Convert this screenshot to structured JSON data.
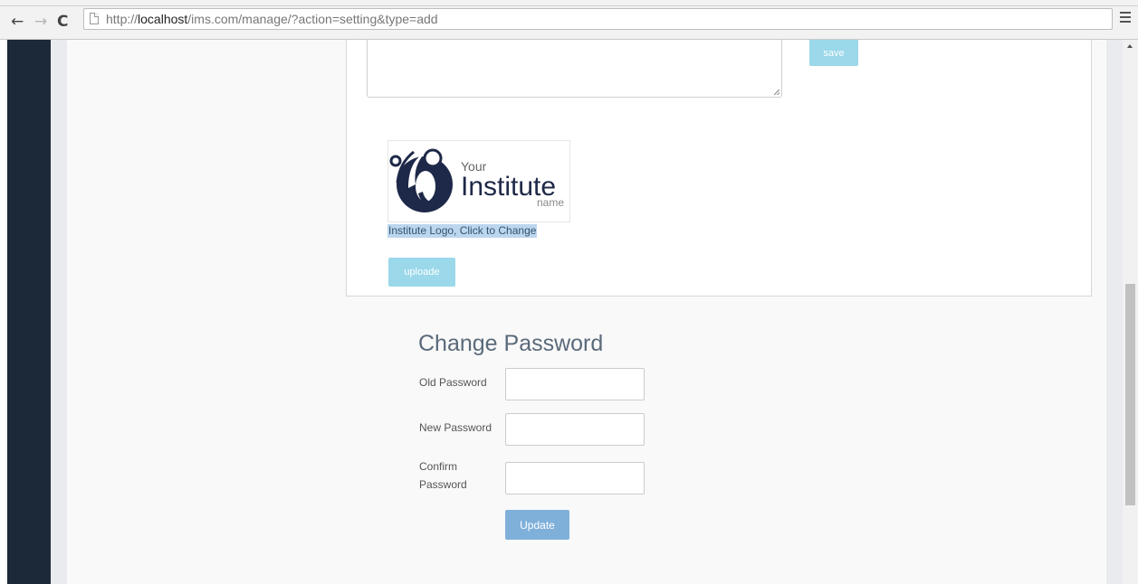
{
  "browser": {
    "url_scheme": "http://",
    "url_host": "localhost",
    "url_path": "/ims.com/manage/?action=setting&type=add",
    "back_glyph": "←",
    "forward_glyph": "→",
    "reload_glyph": "C"
  },
  "settings": {
    "save_label": "save",
    "logo_text_your": "Your",
    "logo_text_institute": "Institute",
    "logo_text_name": "name",
    "logo_caption": "Institute Logo, Click to Change",
    "upload_label": "uploade"
  },
  "password": {
    "title": "Change Password",
    "old_label": "Old Password",
    "new_label": "New Password",
    "confirm_label": "Confirm Password",
    "update_label": "Update"
  },
  "colors": {
    "sidebar": "#1c2938",
    "accent_button": "#9ad8ea",
    "update_button": "#7fb0da"
  }
}
